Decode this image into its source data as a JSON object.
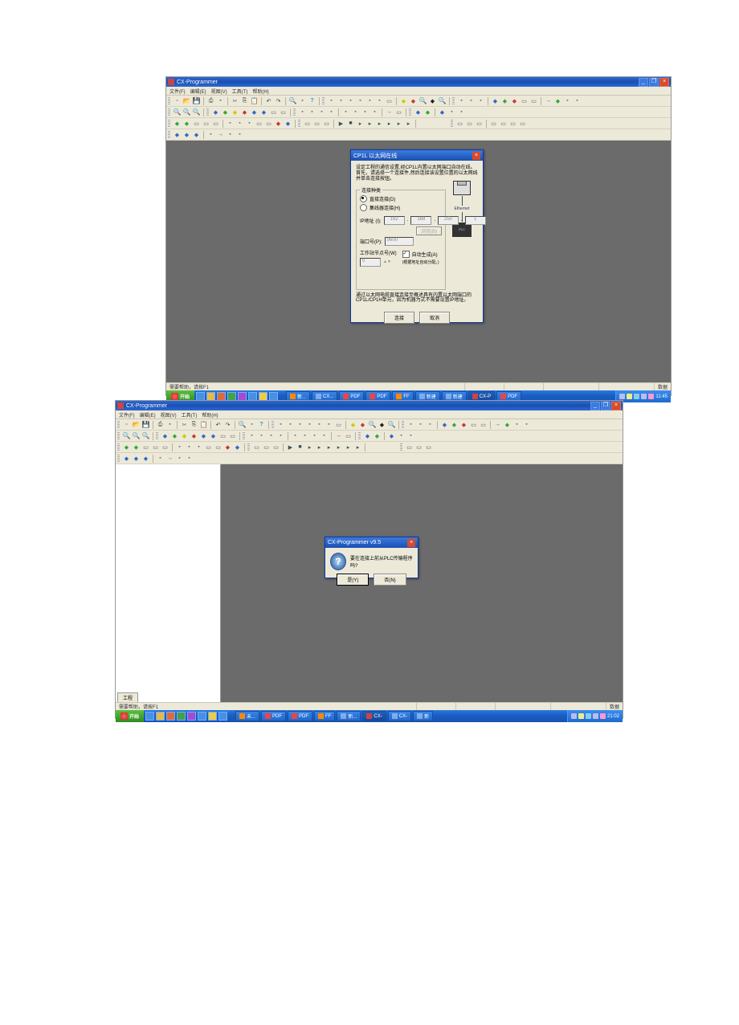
{
  "shot1": {
    "title": "CX-Programmer",
    "menus": [
      "文件(F)",
      "编辑(E)",
      "视图(V)",
      "工具(T)",
      "帮助(H)"
    ],
    "dialog": {
      "title": "CP1L 以太网在线",
      "instruction": "设定工程的通信设置,经CP1L内置以太网端口自动在线。\n首先，请选择一个连接件,然后连接该设置位置的以太网线并单击连接按钮。",
      "conn_group_title": "连接种类",
      "radio_direct": "直接连接(D)",
      "radio_hub": "集线器连接(H)",
      "ip_label": "IP地址 (I):",
      "ip": [
        "192",
        "168",
        "250",
        "1"
      ],
      "browse_btn": "浏览(B)",
      "port_label": "端口号(P):",
      "port_value": "9600",
      "ws_label": "工作站节点号(W)",
      "ws_value": "0",
      "autogen_check": "自动生成(A)",
      "autogen_note": "(根据地址自动分配。)",
      "bottom_note": "通过以太网电缆直接连接至概述具有内置以太网端口的CP1L/CP1H单元，因为机器为式不需要设置IP地址。",
      "ok": "连接",
      "cancel": "取消",
      "eth_label": "Ethernet"
    },
    "status": "需要帮助，请按F1",
    "status_right": "数据",
    "taskbar": {
      "start": "开始",
      "items": [
        "新...",
        "CX...",
        "PDF",
        "PDF",
        "FF",
        "新建",
        "新建",
        "CX-P",
        "PDF"
      ],
      "time": "11:45"
    }
  },
  "shot2": {
    "title": "CX-Programmer",
    "menus": [
      "文件(F)",
      "编辑(E)",
      "视图(V)",
      "工具(T)",
      "帮助(H)"
    ],
    "side_tab": "工程",
    "msgbox": {
      "title": "CX-Programmer v9.5",
      "text": "要在连接上前从PLC传输程序吗?",
      "yes": "是(Y)",
      "no": "否(N)"
    },
    "status": "需要帮助，请按F1",
    "status_right": "数据",
    "taskbar": {
      "start": "开始",
      "items": [
        "未...",
        "PDF",
        "PDF",
        "FF",
        "新...",
        "CX-",
        "CX-",
        "新"
      ],
      "time": "21:02"
    }
  }
}
